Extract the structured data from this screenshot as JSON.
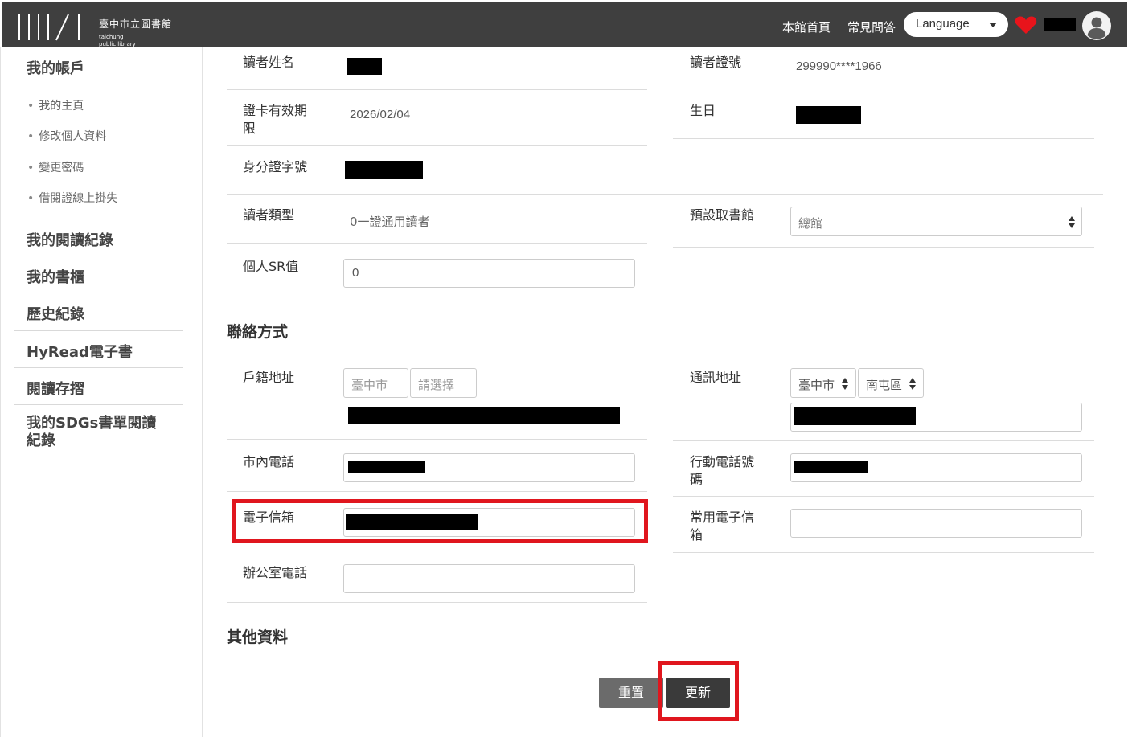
{
  "header": {
    "logo_cn": "臺中市立圖書館",
    "logo_en_line1": "taichung",
    "logo_en_line2": "public library",
    "nav_home": "本館首頁",
    "nav_faq": "常見問答",
    "language_label": "Language",
    "heart_color": "#e8141b"
  },
  "sidebar": {
    "my_account": "我的帳戶",
    "sub_items": [
      "我的主頁",
      "修改個人資料",
      "變更密碼",
      "借閱證線上掛失"
    ],
    "items": [
      "我的閱讀紀錄",
      "我的書櫃",
      "歷史紀錄",
      "HyRead電子書",
      "閱讀存摺"
    ],
    "sdgs_line1": "我的SDGs書單閱讀",
    "sdgs_line2": "紀錄"
  },
  "form": {
    "reader_name_label": "讀者姓名",
    "reader_card_label": "讀者證號",
    "reader_card_value": "299990****1966",
    "card_valid_label_1": "證卡有效期",
    "card_valid_label_2": "限",
    "card_valid_value": "2026/02/04",
    "birthday_label": "生日",
    "id_number_label": "身分證字號",
    "reader_type_label": "讀者類型",
    "reader_type_value": "0一證通用讀者",
    "pickup_library_label": "預設取書館",
    "pickup_library_value": "總館",
    "sr_label": "個人SR值",
    "sr_value": "0"
  },
  "contact": {
    "title": "聯絡方式",
    "household_address_label": "戶籍地址",
    "household_city": "臺中市",
    "household_district": "請選擇",
    "mailing_address_label": "通訊地址",
    "mailing_city": "臺中市",
    "mailing_district": "南屯區",
    "home_phone_label": "市內電話",
    "mobile_label_1": "行動電話號",
    "mobile_label_2": "碼",
    "email_label": "電子信箱",
    "common_email_label_1": "常用電子信",
    "common_email_label_2": "箱",
    "office_phone_label": "辦公室電話"
  },
  "other": {
    "title": "其他資料"
  },
  "buttons": {
    "reset": "重置",
    "update": "更新"
  },
  "colors": {
    "header_bg": "#3f3f3f",
    "highlight": "#e0161e"
  }
}
